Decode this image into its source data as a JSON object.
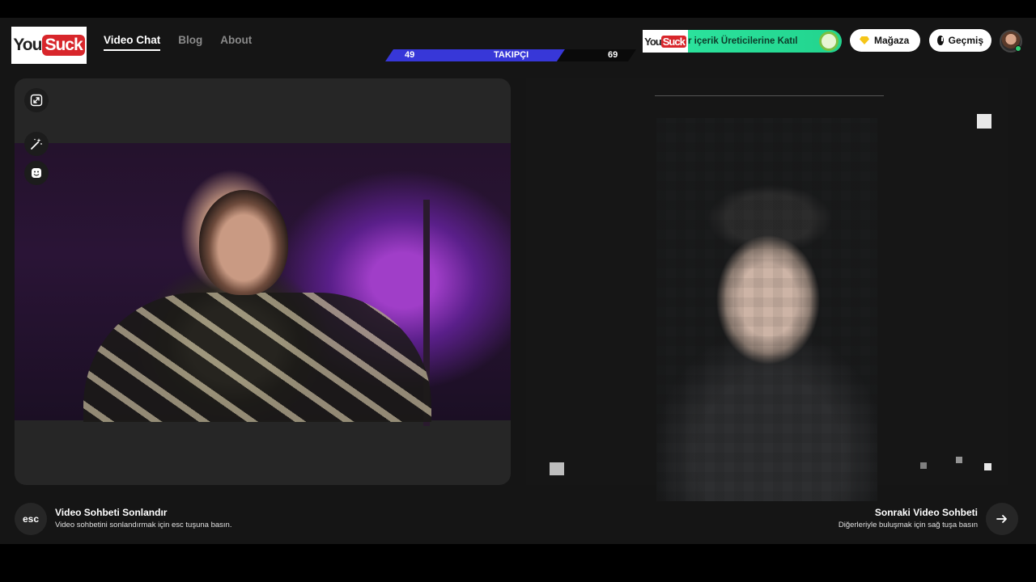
{
  "logo": {
    "you": "You",
    "suck": "Suck"
  },
  "nav": [
    {
      "label": "Video Chat",
      "active": true
    },
    {
      "label": "Blog",
      "active": false
    },
    {
      "label": "About",
      "active": false
    }
  ],
  "followers": {
    "left_count": "49",
    "label": "TAKIPÇI",
    "right_count": "69"
  },
  "promo": {
    "logo_you": "You",
    "logo_suck": "Suck",
    "text": "r içerik Üreticilerine Katıl"
  },
  "header_buttons": {
    "store": "Mağaza",
    "history": "Geçmiş"
  },
  "footer": {
    "esc_key": "esc",
    "end_title": "Video Sohbeti Sonlandır",
    "end_hint": "Video sohbetini sonlandırmak için esc tuşuna basın.",
    "next_title": "Sonraki Video Sohbeti",
    "next_hint": "Diğerleriyle buluşmak için sağ tuşa basın"
  },
  "icons": [
    "expand-icon",
    "magic-wand-icon",
    "emoji-icon",
    "gem-icon",
    "clock-icon",
    "arrow-right-icon"
  ],
  "colors": {
    "accent_blue": "#3737d8",
    "brand_red": "#d8262b",
    "promo_green": "#2ee6a0",
    "online_green": "#2ecc71"
  }
}
